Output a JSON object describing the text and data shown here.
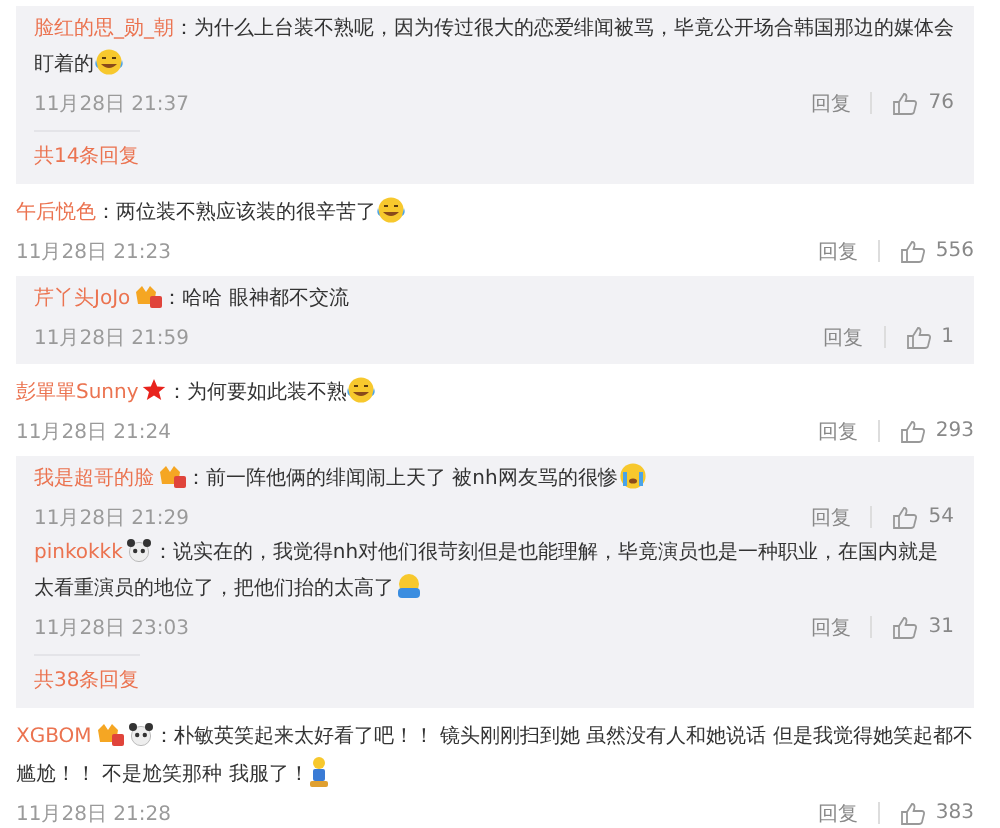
{
  "blocks": [
    {
      "kind": "panel",
      "replies": [
        {
          "user": "脸红的思_勋_朝",
          "text": "：为什么上台装不熟呢，因为传过很大的恋爱绯闻被骂，毕竟公开场合韩国那边的媒体会盯着的",
          "emoji": {
            "kind": "laugh-cry"
          },
          "time": "11月28日 21:37",
          "reply": "回复",
          "likes": "76"
        }
      ],
      "more": "共14条回复"
    },
    {
      "kind": "comment",
      "user": "午后悦色",
      "text": "：两位装不熟应该装的很辛苦了",
      "emoji": {
        "kind": "laugh-cry"
      },
      "time": "11月28日 21:23",
      "reply": "回复",
      "likes": "556"
    },
    {
      "kind": "panel",
      "replies": [
        {
          "user": "芹丫头JoJo",
          "badges": [
            {
              "kind": "vip"
            }
          ],
          "text": "：哈哈 眼神都不交流",
          "time": "11月28日 21:59",
          "reply": "回复",
          "likes": "1"
        }
      ]
    },
    {
      "kind": "comment",
      "user": "彭單單Sunny",
      "badges": [
        {
          "kind": "star"
        }
      ],
      "text": "：为何要如此装不熟",
      "emoji": {
        "kind": "laugh-cry"
      },
      "time": "11月28日 21:24",
      "reply": "回复",
      "likes": "293"
    },
    {
      "kind": "panel",
      "replies": [
        {
          "user": "我是超哥的脸",
          "badges": [
            {
              "kind": "vip"
            }
          ],
          "text": "：前一阵他俩的绯闻闹上天了 被nh网友骂的很惨",
          "emoji": {
            "kind": "cry"
          },
          "time": "11月28日 21:29",
          "reply": "回复",
          "likes": "54"
        },
        {
          "user": "pinkokkk",
          "badges": [
            {
              "kind": "panda"
            }
          ],
          "text": "：说实在的，我觉得nh对他们很苛刻但是也能理解，毕竟演员也是一种职业，在国内就是太看重演员的地位了，把他们抬的太高了",
          "emoji": {
            "kind": "hug"
          },
          "time": "11月28日 23:03",
          "reply": "回复",
          "likes": "31"
        }
      ],
      "more": "共38条回复"
    },
    {
      "kind": "comment",
      "user": "XGBOM",
      "badges": [
        {
          "kind": "vip"
        },
        {
          "kind": "panda"
        }
      ],
      "text": "：朴敏英笑起来太好看了吧！！ 镜头刚刚扫到她 虽然没有人和她说话 但是我觉得她笑起都不尴尬！！ 不是尬笑那种 我服了！",
      "emoji": {
        "kind": "person"
      },
      "time": "11月28日 21:28",
      "reply": "回复",
      "likes": "383"
    }
  ]
}
